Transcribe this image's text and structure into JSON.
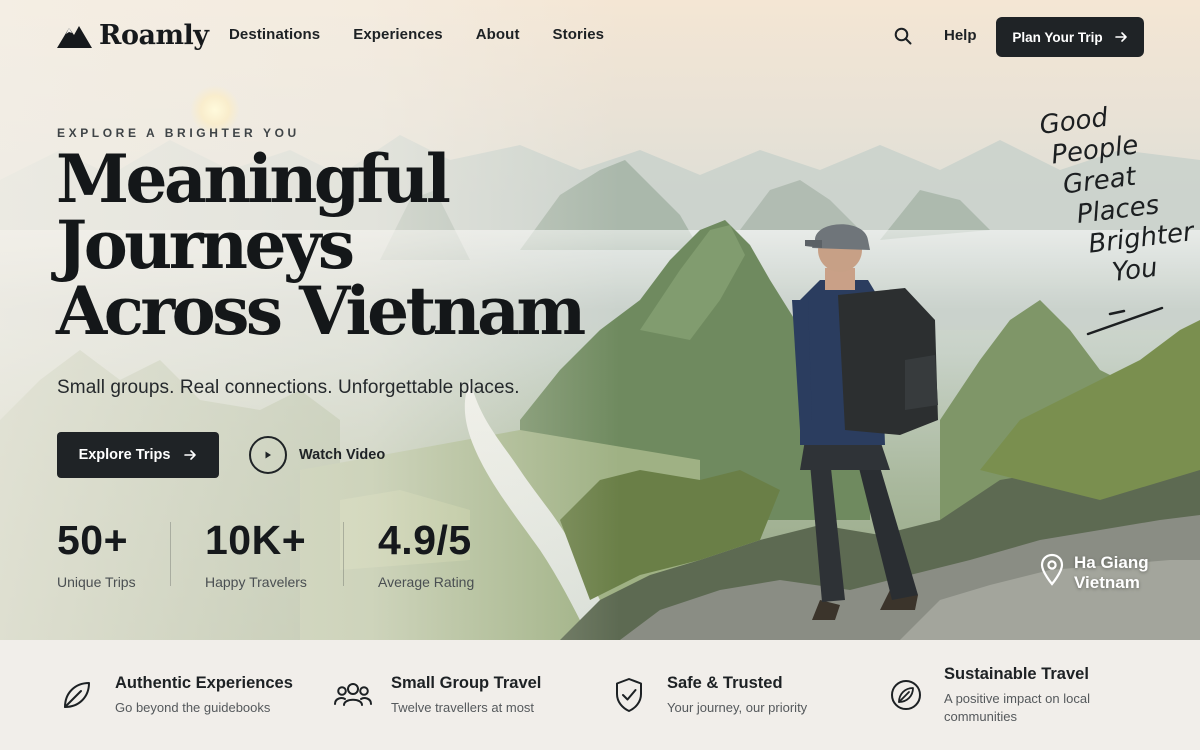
{
  "brand": {
    "name": "Roamly"
  },
  "nav": {
    "links": [
      "Destinations",
      "Experiences",
      "About",
      "Stories"
    ],
    "search_icon": "search-icon",
    "help": "Help",
    "cta": "Plan Your Trip"
  },
  "hero": {
    "eyebrow": "EXPLORE A BRIGHTER YOU",
    "headline": [
      "Meaningful",
      "Journeys",
      "Across Vietnam"
    ],
    "subhead": "Small groups. Real connections. Unforgettable places.",
    "primary_cta": "Explore Trips",
    "video_cta": "Watch Video",
    "stats": [
      {
        "value": "50+",
        "label": "Unique Trips"
      },
      {
        "value": "10K+",
        "label": "Happy Travelers"
      },
      {
        "value": "4.9/5",
        "label": "Average Rating"
      }
    ],
    "handwriting": [
      "Good",
      "People",
      "Great",
      "Places",
      "Brighter",
      "You"
    ],
    "location": {
      "line1": "Ha Giang",
      "line2": "Vietnam",
      "icon": "map-pin-icon"
    }
  },
  "features": [
    {
      "icon": "leaf-icon",
      "title": "Authentic Experiences",
      "desc": "Go beyond the guidebooks"
    },
    {
      "icon": "group-icon",
      "title": "Small Group Travel",
      "desc": "Twelve travellers at most"
    },
    {
      "icon": "shield-check-icon",
      "title": "Safe & Trusted",
      "desc": "Your journey, our priority"
    },
    {
      "icon": "leaf-circle-icon",
      "title": "Sustainable Travel",
      "desc": "A positive impact on local communities"
    }
  ],
  "colors": {
    "dark": "#1f2326",
    "feature_bg": "#f1eeea",
    "white": "#ffffff"
  }
}
